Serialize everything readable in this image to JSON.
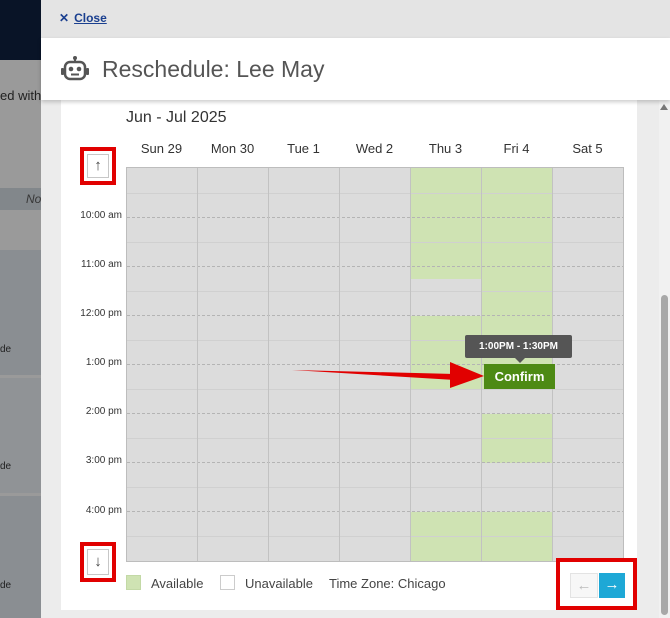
{
  "background": {
    "text_with": "ed with:",
    "text_no": "No",
    "text_de": [
      "de",
      "de",
      "de"
    ]
  },
  "panel": {
    "close_label": "Close",
    "title": "Reschedule: Lee May",
    "header_icon": "robot-icon"
  },
  "calendar": {
    "month_label": "Jun - Jul 2025",
    "days": [
      "Sun 29",
      "Mon 30",
      "Tue 1",
      "Wed 2",
      "Thu 3",
      "Fri 4",
      "Sat 5"
    ],
    "time_labels": [
      "10:00 am",
      "11:00 am",
      "12:00 pm",
      "1:00 pm",
      "2:00 pm",
      "3:00 pm",
      "4:00 pm"
    ],
    "available_color": "#cfe3b3",
    "unavailable_color": "#dcdcdc",
    "tooltip": "1:00PM - 1:30PM",
    "confirm_label": "Confirm",
    "confirm_color": "#4d8a14"
  },
  "navigation": {
    "up_icon": "arrow-up-icon",
    "down_icon": "arrow-down-icon",
    "prev_icon": "arrow-left-icon",
    "next_icon": "arrow-right-icon",
    "next_color": "#1ea8d6",
    "highlight_color": "#e10000"
  },
  "legend": {
    "available": "Available",
    "unavailable": "Unavailable",
    "timezone": "Time Zone: Chicago"
  }
}
